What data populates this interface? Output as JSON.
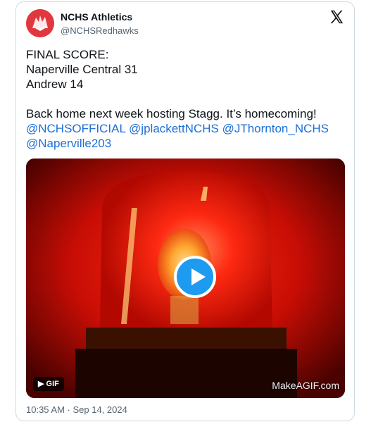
{
  "tweet": {
    "author_name": "NCHS Athletics",
    "author_handle": "@NCHSRedhawks",
    "text_line1": "FINAL SCORE:",
    "text_line2": "Naperville Central 31",
    "text_line3": "Andrew 14",
    "text_line4": "Back home next week hosting Stagg. It’s homecoming!",
    "mentions": [
      "@NCHSOFFICIAL",
      "@jplackettNCHS",
      "@JThornton_NCHS",
      "@Naperville203"
    ],
    "timestamp": "10:35 AM · Sep 14, 2024"
  },
  "media": {
    "badge_label": "GIF",
    "watermark": "MakeAGIF.com"
  },
  "icons": {
    "platform": "x-logo-icon",
    "media_play": "play-icon"
  },
  "colors": {
    "mention": "#1d6fd6",
    "play_button": "#1d9bf0",
    "avatar_bg": "#e0383e"
  }
}
